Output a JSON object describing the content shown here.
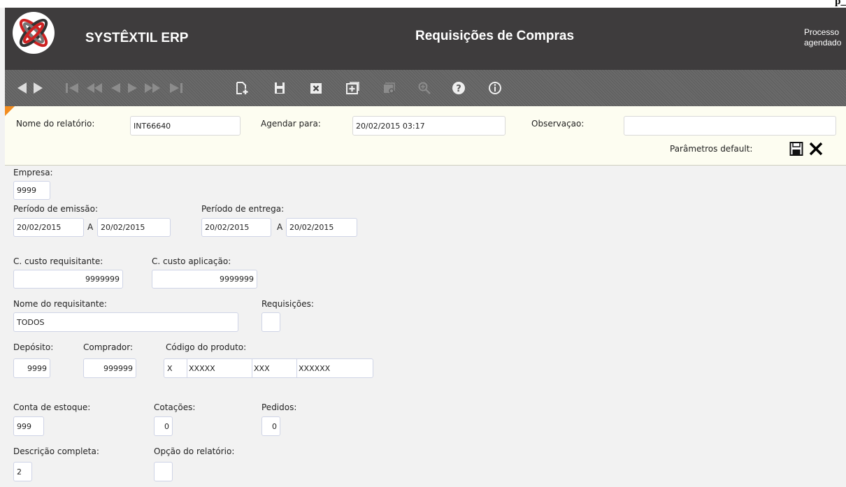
{
  "top_strip_text": "p_",
  "header": {
    "brand": "SYSTÊXTIL ERP",
    "screen_title": "Requisições de Compras",
    "process_text_line1": "Processo",
    "process_text_line2": "agendado"
  },
  "toolbar": {
    "icons": [
      "back-icon",
      "forward-icon",
      "first-icon",
      "previous-page-icon",
      "previous-icon",
      "next-icon",
      "next-page-icon",
      "last-icon",
      "new-record-icon",
      "save-icon",
      "delete-icon",
      "add-icon",
      "list-search-icon",
      "zoom-icon",
      "help-icon",
      "info-icon"
    ]
  },
  "report_params": {
    "report_name_label": "Nome do relatório:",
    "report_name_value": "INT66640",
    "schedule_label": "Agendar para:",
    "schedule_value": "20/02/2015 03:17",
    "observation_label": "Observaçao:",
    "observation_value": "",
    "default_params_label": "Parâmetros default:"
  },
  "form": {
    "empresa_label": "Empresa:",
    "empresa_value": "9999",
    "periodo_emissao_label": "Período de emissão:",
    "emissao_from": "20/02/2015",
    "emissao_sep": "A",
    "emissao_to": "20/02/2015",
    "periodo_entrega_label": "Período de entrega:",
    "entrega_from": "20/02/2015",
    "entrega_sep": "A",
    "entrega_to": "20/02/2015",
    "cc_requisitante_label": "C. custo requisitante:",
    "cc_requisitante_value": "9999999",
    "cc_aplicacao_label": "C. custo aplicação:",
    "cc_aplicacao_value": "9999999",
    "nome_requisitante_label": "Nome do requisitante:",
    "nome_requisitante_value": "TODOS",
    "requisicoes_label": "Requisições:",
    "requisicoes_value": "",
    "deposito_label": "Depósito:",
    "deposito_value": "9999",
    "comprador_label": "Comprador:",
    "comprador_value": "999999",
    "codigo_produto_label": "Código do produto:",
    "codigo_produto_1": "X",
    "codigo_produto_2": "XXXXX",
    "codigo_produto_3": "XXX",
    "codigo_produto_4": "XXXXXX",
    "conta_estoque_label": "Conta de estoque:",
    "conta_estoque_value": "999",
    "cotacoes_label": "Cotações:",
    "cotacoes_value": "0",
    "pedidos_label": "Pedidos:",
    "pedidos_value": "0",
    "descricao_completa_label": "Descrição completa:",
    "descricao_completa_value": "2",
    "opcao_relatorio_label": "Opção do relatório:",
    "opcao_relatorio_value": ""
  }
}
